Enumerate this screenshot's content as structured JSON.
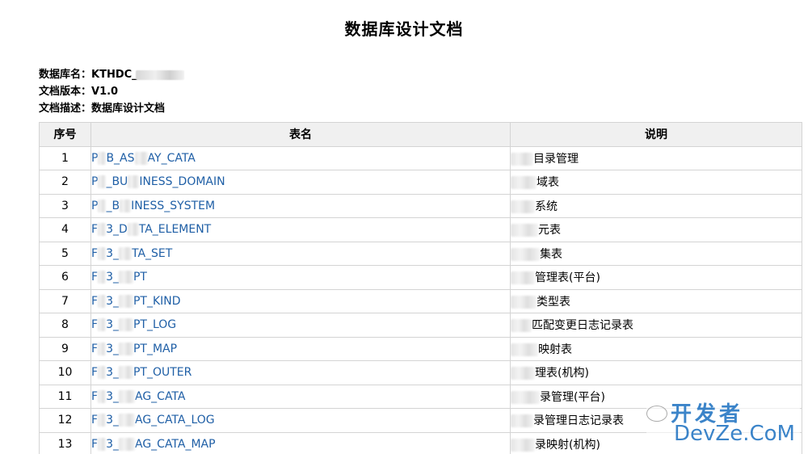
{
  "document": {
    "title": "数据库设计文档",
    "meta": {
      "db_name_label": "数据库名：",
      "db_name_value": "KTHDC_",
      "version_label": "文档版本：",
      "version_value": "V1.0",
      "desc_label": "文档描述：",
      "desc_value": "数据库设计文档"
    }
  },
  "table": {
    "headers": [
      "序号",
      "表名",
      "说明"
    ],
    "rows": [
      {
        "num": "1",
        "name_pre": "P",
        "name_post": "B_AS",
        "name_tail": "AY_CATA",
        "desc": "目录管理"
      },
      {
        "num": "2",
        "name_pre": "P",
        "name_post": "_BU",
        "name_tail": "INESS_DOMAIN",
        "desc": "域表"
      },
      {
        "num": "3",
        "name_pre": "P",
        "name_post": "_B",
        "name_tail": "INESS_SYSTEM",
        "desc": "系统"
      },
      {
        "num": "4",
        "name_pre": "F",
        "name_post": "3_D",
        "name_tail": "TA_ELEMENT",
        "desc": "元表"
      },
      {
        "num": "5",
        "name_pre": "F",
        "name_post": "3_",
        "name_tail": "TA_SET",
        "desc": "集表"
      },
      {
        "num": "6",
        "name_pre": "F",
        "name_post": "3_",
        "name_tail": "PT",
        "desc": "管理表(平台)"
      },
      {
        "num": "7",
        "name_pre": "F",
        "name_post": "3_",
        "name_tail": "PT_KIND",
        "desc": "类型表"
      },
      {
        "num": "8",
        "name_pre": "F",
        "name_post": "3_",
        "name_tail": "PT_LOG",
        "desc": "匹配变更日志记录表"
      },
      {
        "num": "9",
        "name_pre": "F",
        "name_post": "3_",
        "name_tail": "PT_MAP",
        "desc": "映射表"
      },
      {
        "num": "10",
        "name_pre": "F",
        "name_post": "3_",
        "name_tail": "PT_OUTER",
        "desc": "理表(机构)"
      },
      {
        "num": "11",
        "name_pre": "F",
        "name_post": "3_",
        "name_tail": "AG_CATA",
        "desc": "录管理(平台)"
      },
      {
        "num": "12",
        "name_pre": "F",
        "name_post": "3_",
        "name_tail": "AG_CATA_LOG",
        "desc": "录管理日志记录表"
      },
      {
        "num": "13",
        "name_pre": "F",
        "name_post": "3_",
        "name_tail": "AG_CATA_MAP",
        "desc": "录映射(机构)"
      }
    ]
  },
  "watermark": {
    "line1": "开发者",
    "line2": "DevZe.CoM"
  }
}
